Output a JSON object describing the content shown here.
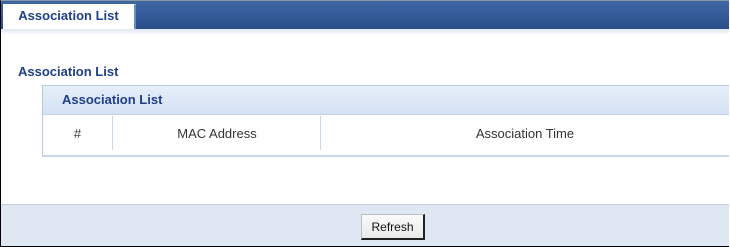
{
  "tabs": [
    {
      "label": "Association List",
      "active": true
    }
  ],
  "section": {
    "title": "Association List"
  },
  "table": {
    "title": "Association List",
    "columns": [
      "#",
      "MAC Address",
      "Association Time"
    ],
    "rows": []
  },
  "footer": {
    "refresh_label": "Refresh"
  },
  "colors": {
    "tabbar": "#2f5793",
    "heading_text": "#1f3f8a",
    "panel_header": "#dbe6f5",
    "footer_bg": "#dfe7f2"
  }
}
